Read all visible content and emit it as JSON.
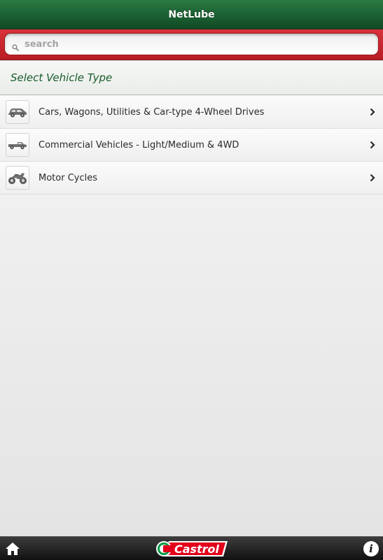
{
  "header": {
    "title": "NetLube"
  },
  "search": {
    "placeholder": "search",
    "value": ""
  },
  "section": {
    "title": "Select Vehicle Type"
  },
  "vehicle_types": [
    {
      "label": "Cars, Wagons, Utilities & Car-type 4-Wheel Drives",
      "icon": "car-icon"
    },
    {
      "label": "Commercial Vehicles - Light/Medium & 4WD",
      "icon": "truck-icon"
    },
    {
      "label": "Motor Cycles",
      "icon": "motorcycle-icon"
    }
  ],
  "footer": {
    "logo_text": "Castrol",
    "home_icon": "home-icon",
    "info_icon": "info-icon"
  },
  "colors": {
    "header_green": "#1d6435",
    "search_red": "#c8262f",
    "section_text": "#1a5c2b",
    "footer_dark": "#1a1a1a",
    "castrol_red": "#e2001a",
    "castrol_green": "#009a44"
  }
}
